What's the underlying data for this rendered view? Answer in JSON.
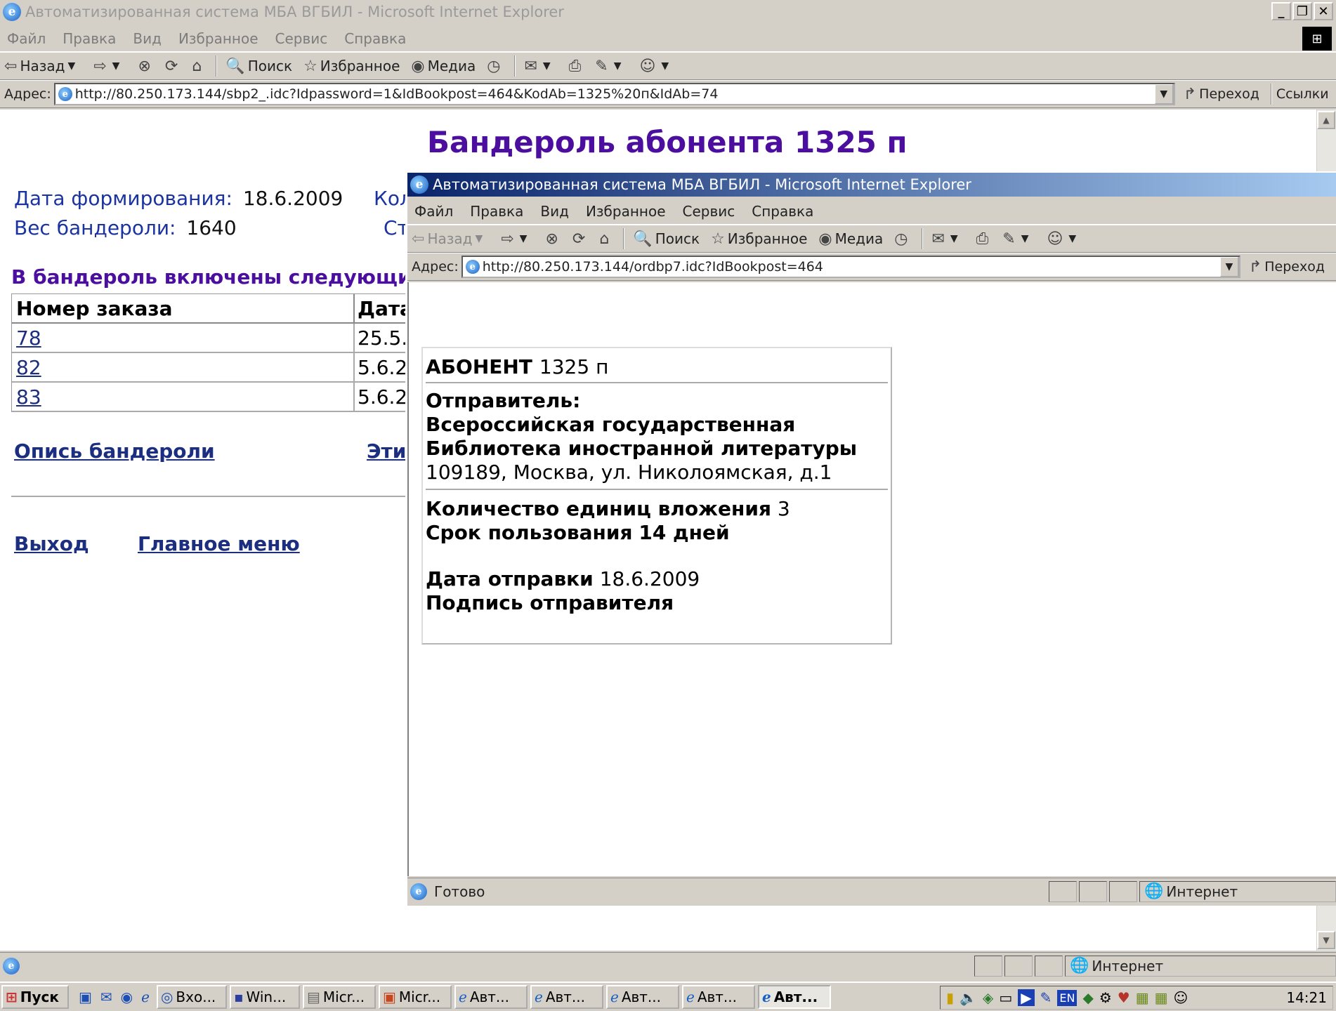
{
  "main_window": {
    "title": "Автоматизированная система МБА ВГБИЛ - Microsoft Internet Explorer",
    "menu": [
      "Файл",
      "Правка",
      "Вид",
      "Избранное",
      "Сервис",
      "Справка"
    ],
    "toolbar": {
      "back": "Назад",
      "search": "Поиск",
      "favorites": "Избранное",
      "media": "Медиа"
    },
    "address_label": "Адрес:",
    "address": "http://80.250.173.144/sbp2_.idc?Idpassword=1&IdBookpost=464&KodAb=1325%20п&IdAb=74",
    "go": "Переход",
    "links": "Ссылки",
    "status_zone": "Интернет"
  },
  "main_page": {
    "heading": "Бандероль абонента 1325 п",
    "date_label": "Дата формирования:",
    "date_value": "18.6.2009",
    "weight_label": "Вес бандероли:",
    "weight_value": "1640",
    "col2_row1_partial": "Кол",
    "col2_row2_partial": "Ст",
    "included_heading": "В бандероль включены следующие",
    "table": {
      "headers": [
        "Номер заказа",
        "Дата"
      ],
      "rows": [
        [
          "78",
          "25.5."
        ],
        [
          "82",
          "5.6.2"
        ],
        [
          "83",
          "5.6.2"
        ]
      ]
    },
    "inventory_link": "Опись бандероли",
    "partial_link": "Эти",
    "exit_link": "Выход",
    "main_menu_link": "Главное меню"
  },
  "popup_window": {
    "title": "Автоматизированная система МБА ВГБИЛ - Microsoft Internet Explorer",
    "menu": [
      "Файл",
      "Правка",
      "Вид",
      "Избранное",
      "Сервис",
      "Справка"
    ],
    "toolbar": {
      "back": "Назад",
      "search": "Поиск",
      "favorites": "Избранное",
      "media": "Медиа"
    },
    "address_label": "Адрес:",
    "address": "http://80.250.173.144/ordbp7.idc?IdBookpost=464",
    "go": "Переход",
    "status_ready": "Готово",
    "status_zone": "Интернет"
  },
  "label_card": {
    "subscriber_label": "АБОНЕНТ",
    "subscriber_value": "1325 п",
    "sender_label": "Отправитель:",
    "sender_line1": "Всероссийская государственная",
    "sender_line2": "Библиотека иностранной литературы",
    "sender_address": "109189, Москва, ул. Николоямская, д.1",
    "items_label": "Количество единиц вложения",
    "items_value": "3",
    "period_label": "Срок пользования",
    "period_value": "14 дней",
    "send_date_label": "Дата отправки",
    "send_date_value": "18.6.2009",
    "signature_label": "Подпись отправителя"
  },
  "taskbar": {
    "start": "Пуск",
    "buttons": [
      "Вхо...",
      "Win...",
      "Micr...",
      "Micr...",
      "Авт...",
      "Авт...",
      "Авт...",
      "Авт...",
      "Авт..."
    ],
    "tray_lang": "EN",
    "clock": "14:21"
  }
}
